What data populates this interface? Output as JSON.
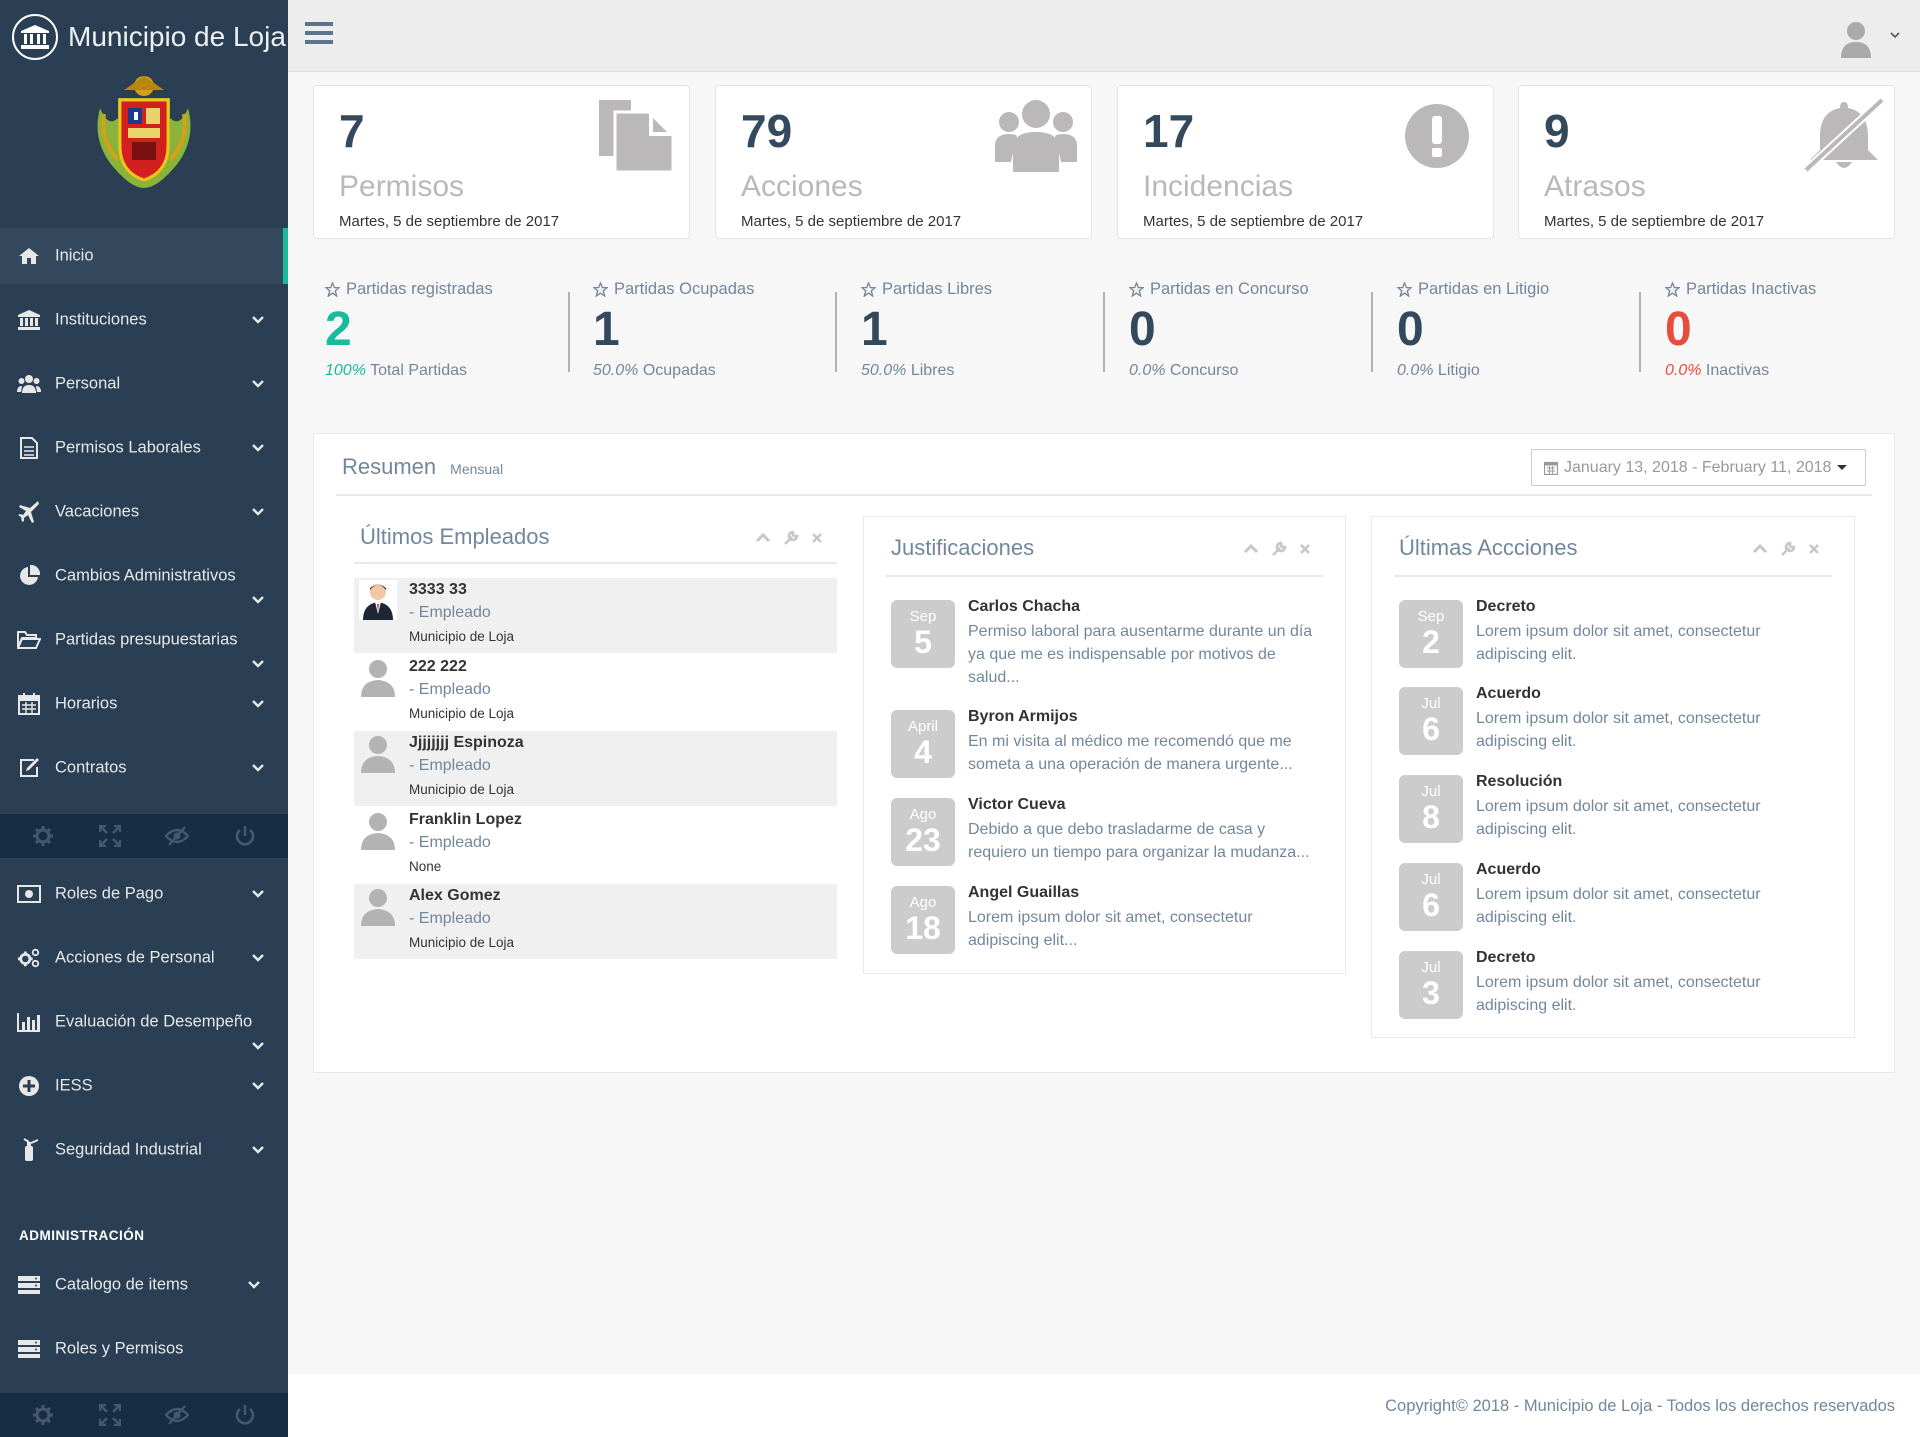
{
  "app": {
    "title": "Municipio de Loja",
    "logo_icon": "bank-icon",
    "crest_icon": "municipal-crest"
  },
  "sidebar": {
    "items": [
      {
        "label": "Inicio",
        "icon": "home-icon"
      },
      {
        "label": "Instituciones",
        "icon": "bank-icon"
      },
      {
        "label": "Personal",
        "icon": "users-icon"
      },
      {
        "label": "Permisos Laborales",
        "icon": "file-icon"
      },
      {
        "label": "Vacaciones",
        "icon": "plane-icon"
      },
      {
        "label": "Cambios Administrativos",
        "icon": "pie-chart-icon"
      },
      {
        "label": "Partidas presupuestarias",
        "icon": "folder-open-icon"
      },
      {
        "label": "Horarios",
        "icon": "calendar-icon"
      },
      {
        "label": "Contratos",
        "icon": "edit-icon"
      },
      {
        "label": "Roles de Pago",
        "icon": "money-icon"
      },
      {
        "label": "Acciones de Personal",
        "icon": "cogs-icon"
      },
      {
        "label": "Evaluación de Desempeño",
        "icon": "bar-chart-icon"
      },
      {
        "label": "IESS",
        "icon": "plus-circle-icon"
      },
      {
        "label": "Seguridad Industrial",
        "icon": "fire-extinguisher-icon"
      }
    ],
    "admin_section": "ADMINISTRACIÓN",
    "admin_items": [
      {
        "label": "Catalogo de items",
        "icon": "server-icon"
      },
      {
        "label": "Roles y Permisos",
        "icon": "server-icon"
      }
    ],
    "footer_icons": [
      "gear-icon",
      "fullscreen-icon",
      "eye-slash-icon",
      "power-icon"
    ]
  },
  "tiles": [
    {
      "count": "7",
      "label": "Permisos",
      "date": "Martes, 5 de septiembre de 2017",
      "icon": "files-icon"
    },
    {
      "count": "79",
      "label": "Acciones",
      "date": "Martes, 5 de septiembre de 2017",
      "icon": "users-icon"
    },
    {
      "count": "17",
      "label": "Incidencias",
      "date": "Martes, 5 de septiembre de 2017",
      "icon": "exclamation-circle-icon"
    },
    {
      "count": "9",
      "label": "Atrasos",
      "date": "Martes, 5 de septiembre de 2017",
      "icon": "bell-slash-icon"
    }
  ],
  "stats": [
    {
      "label": "Partidas registradas",
      "value": "2",
      "pct": "100%",
      "foot": "Total Partidas"
    },
    {
      "label": "Partidas Ocupadas",
      "value": "1",
      "pct": "50.0%",
      "foot": "Ocupadas"
    },
    {
      "label": "Partidas Libres",
      "value": "1",
      "pct": "50.0%",
      "foot": "Libres"
    },
    {
      "label": "Partidas en Concurso",
      "value": "0",
      "pct": "0.0%",
      "foot": "Concurso"
    },
    {
      "label": "Partidas en Litigio",
      "value": "0",
      "pct": "0.0%",
      "foot": "Litigio"
    },
    {
      "label": "Partidas Inactivas",
      "value": "0",
      "pct": "0.0%",
      "foot": "Inactivas"
    }
  ],
  "colors": {
    "accent": "#1abb9c",
    "danger": "#e74c3c",
    "sidebar": "#2a3f54",
    "date_badge": "#cccccc"
  },
  "resumen": {
    "title": "Resumen",
    "subtitle": "Mensual",
    "daterange": "January 13, 2018 - February 11, 2018"
  },
  "empleados": {
    "title": "Últimos Empleados",
    "rows": [
      {
        "name": "3333 33",
        "role": "- Empleado",
        "org": "Municipio de Loja",
        "avatar": "photo"
      },
      {
        "name": "222 222",
        "role": "- Empleado",
        "org": "Municipio de Loja",
        "avatar": "default"
      },
      {
        "name": "Jjjjjjjj Espinoza",
        "role": "- Empleado",
        "org": "Municipio de Loja",
        "avatar": "default"
      },
      {
        "name": "Franklin Lopez",
        "role": "- Empleado",
        "org": "None",
        "avatar": "default"
      },
      {
        "name": "Alex Gomez",
        "role": "- Empleado",
        "org": "Municipio de Loja",
        "avatar": "default"
      }
    ]
  },
  "justificaciones": {
    "title": "Justificaciones",
    "items": [
      {
        "mon": "Sep",
        "day": "5",
        "title": "Carlos Chacha",
        "text": "Permiso laboral para ausentarme durante un día ya que me es indispensable por motivos de salud..."
      },
      {
        "mon": "April",
        "day": "4",
        "title": "Byron Armijos",
        "text": "En mi visita al médico me recomendó que me someta a una operación de manera urgente..."
      },
      {
        "mon": "Ago",
        "day": "23",
        "title": "Victor Cueva",
        "text": "Debido a que debo trasladarme de casa y requiero un tiempo para organizar la mudanza..."
      },
      {
        "mon": "Ago",
        "day": "18",
        "title": "Angel Guaillas",
        "text": "Lorem ipsum dolor sit amet, consectetur adipiscing elit..."
      }
    ]
  },
  "acciones": {
    "title": "Últimas Accciones",
    "items": [
      {
        "mon": "Sep",
        "day": "2",
        "title": "Decreto",
        "text": "Lorem ipsum dolor sit amet, consectetur adipiscing elit."
      },
      {
        "mon": "Jul",
        "day": "6",
        "title": "Acuerdo",
        "text": "Lorem ipsum dolor sit amet, consectetur adipiscing elit."
      },
      {
        "mon": "Jul",
        "day": "8",
        "title": "Resolución",
        "text": "Lorem ipsum dolor sit amet, consectetur adipiscing elit."
      },
      {
        "mon": "Jul",
        "day": "6",
        "title": "Acuerdo",
        "text": "Lorem ipsum dolor sit amet, consectetur adipiscing elit."
      },
      {
        "mon": "Jul",
        "day": "3",
        "title": "Decreto",
        "text": "Lorem ipsum dolor sit amet, consectetur adipiscing elit."
      }
    ]
  },
  "footer": {
    "copyright": "Copyright© 2018 - Municipio de Loja - Todos los derechos reservados"
  }
}
